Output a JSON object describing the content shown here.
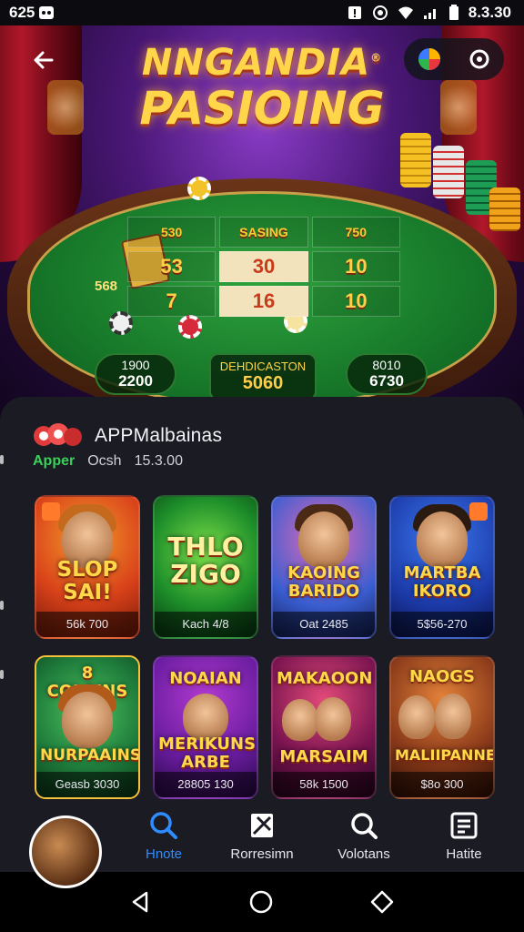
{
  "status_bar": {
    "left_text": "625",
    "time": "8.3.30"
  },
  "hero": {
    "title_line1": "NNGANDIA",
    "title_mark": "®",
    "title_line2": "PASIOING",
    "table": {
      "grid": [
        [
          "530",
          "SASING",
          "750"
        ],
        [
          "53",
          "30",
          "10"
        ],
        [
          "7",
          "16",
          "10"
        ]
      ],
      "left_label": "568",
      "pod_left": {
        "label": "1900",
        "value": "2200"
      },
      "pod_center": {
        "label": "DEHDICASTON",
        "value": "5060"
      },
      "pod_right": {
        "label": "8010",
        "value": "6730"
      }
    }
  },
  "app": {
    "name": "APPMalbainas",
    "tag": "Apper",
    "meta_label": "Ocsh",
    "meta_value": "15.3.00"
  },
  "games": [
    {
      "title": "SLOP SAI!",
      "price": "56k 700",
      "bg": "#d9421a"
    },
    {
      "title": "THLO ZIGO",
      "price": "Kach 4/8",
      "bg": "#1e8f2a"
    },
    {
      "title": "KAOING BARIDO",
      "price": "Oat 2485",
      "bg": "#3a5ed1"
    },
    {
      "title": "MARTBA IKORO",
      "price": "5$56-270",
      "bg": "#1c3aa8"
    },
    {
      "title": "NURPAAINS",
      "subtitle": "8 COLAINS",
      "price": "Geasb 3030",
      "bg": "#1f7d3c"
    },
    {
      "title": "MERIKUNS ARBE",
      "subtitle": "NOAIAN",
      "price": "28805 130",
      "bg": "#6a1da0"
    },
    {
      "title": "MARSAIM",
      "subtitle": "MAKAOON",
      "price": "58k 1500",
      "bg": "#7a1450"
    },
    {
      "title": "MALIIPANNE",
      "subtitle": "NAOGS",
      "price": "$8o 300",
      "bg": "#8a3a1a"
    }
  ],
  "bottom_nav": [
    {
      "label": "Hnote",
      "icon": "search-icon",
      "active": true
    },
    {
      "label": "Rorresimn",
      "icon": "cards-icon",
      "active": false
    },
    {
      "label": "Volotans",
      "icon": "magnifier-icon",
      "active": false
    },
    {
      "label": "Hatite",
      "icon": "list-icon",
      "active": false
    }
  ],
  "colors": {
    "accent": "#2f8cff",
    "gold": "#ffd84a",
    "tag_green": "#3ccf5a"
  }
}
